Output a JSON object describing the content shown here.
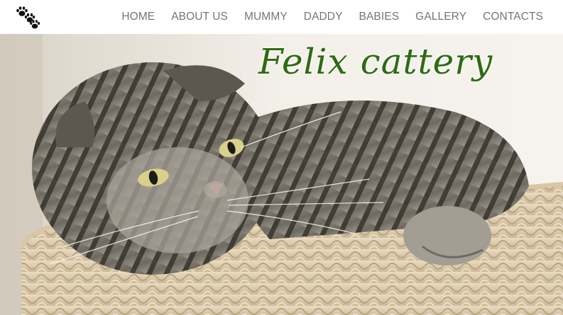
{
  "header": {
    "logo_icon": "paw-prints-icon",
    "nav": [
      {
        "label": "HOME"
      },
      {
        "label": "ABOUT US"
      },
      {
        "label": "MUMMY"
      },
      {
        "label": "DADDY"
      },
      {
        "label": "BABIES"
      },
      {
        "label": "GALLERY"
      },
      {
        "label": "CONTACTS"
      }
    ]
  },
  "hero": {
    "title": "Felix cattery",
    "title_color": "#2e6b14",
    "image_subject": "tabby scottish fold cat lying in a wicker basket"
  },
  "colors": {
    "nav_text": "#757575",
    "background": "#ffffff"
  }
}
